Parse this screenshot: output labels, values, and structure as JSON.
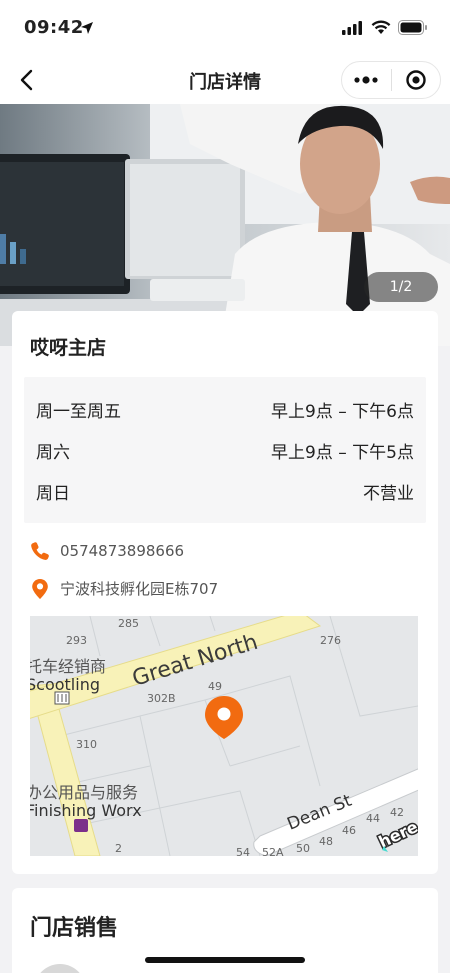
{
  "status_bar": {
    "time": "09:42"
  },
  "nav": {
    "title": "门店详情"
  },
  "banner": {
    "page_indicator": "1/2"
  },
  "store": {
    "name": "哎呀主店",
    "hours": [
      {
        "days": "周一至周五",
        "time": "早上9点 – 下午6点"
      },
      {
        "days": "周六",
        "time": "早上9点 – 下午5点"
      },
      {
        "days": "周日",
        "time": "不营业"
      }
    ],
    "phone": "0574873898666",
    "address": "宁波科技孵化园E栋707",
    "accent_color": "#f26b10"
  },
  "map": {
    "road_main": "Great North",
    "road_secondary": "Dean St",
    "poi_1_cn": "托车经销商",
    "poi_1_en": "Scootling",
    "poi_2_cn": "办公用品与服务",
    "poi_2_en": "Finishing Worx",
    "numbers": [
      "285",
      "293",
      "276",
      "49",
      "302B",
      "310",
      "2",
      "54",
      "52A",
      "50",
      "48",
      "46",
      "44",
      "42"
    ],
    "brand": "here"
  },
  "sales": {
    "title": "门店销售"
  }
}
